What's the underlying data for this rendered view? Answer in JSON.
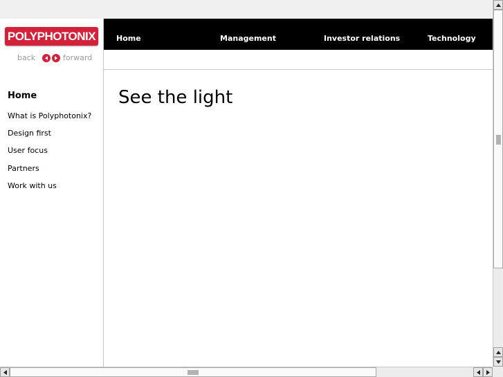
{
  "brand": {
    "logo_text": "POLYPHOTONIX",
    "accent": "#d4213a"
  },
  "history_nav": {
    "back_label": "back",
    "forward_label": "forward"
  },
  "sidebar": {
    "items": [
      {
        "label": "Home",
        "active": true
      },
      {
        "label": "What is Polyphotonix?"
      },
      {
        "label": "Design first"
      },
      {
        "label": "User focus"
      },
      {
        "label": "Partners"
      },
      {
        "label": "Work with us"
      }
    ]
  },
  "topnav": {
    "items": [
      {
        "label": "Home"
      },
      {
        "label": "Management"
      },
      {
        "label": "Investor relations"
      },
      {
        "label": "Technology"
      }
    ]
  },
  "main": {
    "headline": "See the light"
  },
  "colors": {
    "nav_bg": "#000000",
    "nav_text": "#ffffff"
  },
  "icons": [
    "back-arrow-icon",
    "forward-arrow-icon",
    "scroll-up-icon",
    "scroll-down-icon",
    "scroll-left-icon",
    "scroll-right-icon"
  ]
}
